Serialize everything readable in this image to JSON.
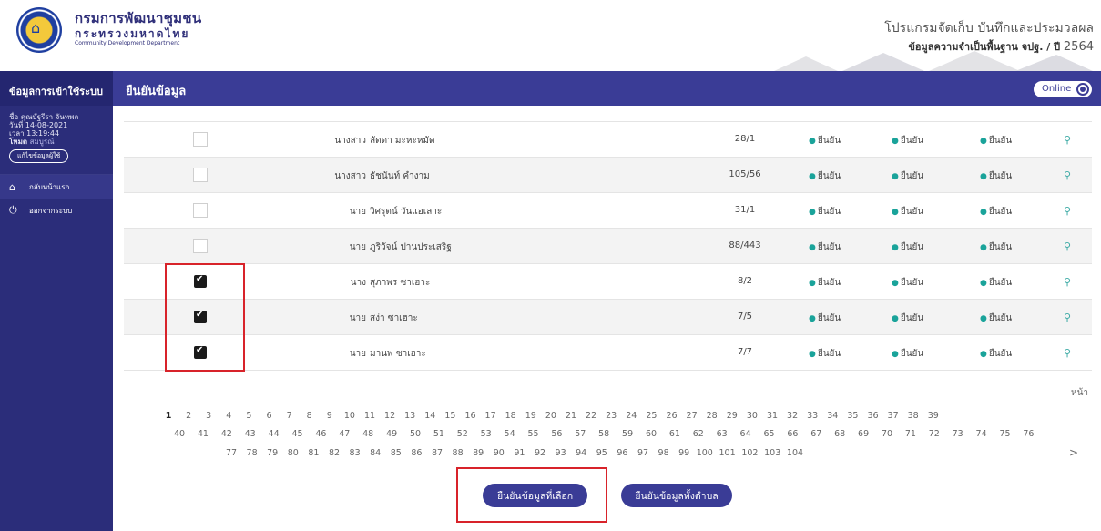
{
  "header": {
    "org_name_th": "กรมการพัฒนาชุมชน",
    "ministry_th": "กระทรวงมหาดไทย",
    "org_name_en": "Community Development Department",
    "app_title": "โปรแกรมจัดเก็บ บันทึกและประมวลผล",
    "app_subtitle": "ข้อมูลความจำเป็นพื้นฐาน จปฐ. / ปี",
    "app_year": "2564"
  },
  "sidebar": {
    "heading": "ข้อมูลการเข้าใช้ระบบ",
    "user_name": "ชื่อ คุณบัฐรีรา จันทพล",
    "date": "วันที่ 14-08-2021",
    "time": "เวลา 13:19:44",
    "role_label": "โหมด",
    "role_value": "สมบูรณ์",
    "edit_profile": "แก้ไขข้อมูลผู้ใช้",
    "menu": [
      {
        "icon": "home-icon",
        "label": "กลับหน้าแรก"
      },
      {
        "icon": "power-icon",
        "label": "ออกจากระบบ"
      }
    ]
  },
  "topbar": {
    "title": "ยืนยันข้อมูล",
    "status": "Online"
  },
  "table": {
    "status_label": "ยืนยัน",
    "rows": [
      {
        "title": "นางสาว",
        "name": "ลัดดา มะหะหมัด",
        "house": "28/1",
        "checked": false
      },
      {
        "title": "นางสาว",
        "name": "ธัชนันท์ คำงาม",
        "house": "105/56",
        "checked": false
      },
      {
        "title": "นาย",
        "name": "วิศรุตน์ วันแอเลาะ",
        "house": "31/1",
        "checked": false
      },
      {
        "title": "นาย",
        "name": "ภูริวัจน์ ปานประเสริฐ",
        "house": "88/443",
        "checked": false
      },
      {
        "title": "นาง",
        "name": "สุภาพร ซาเฮาะ",
        "house": "8/2",
        "checked": true
      },
      {
        "title": "นาย",
        "name": "สง่า ซาเฮาะ",
        "house": "7/5",
        "checked": true
      },
      {
        "title": "นาย",
        "name": "มานพ ซาเฮาะ",
        "house": "7/7",
        "checked": true
      }
    ],
    "action_icon": "view-icon"
  },
  "pagination": {
    "label": "หน้า",
    "current": 1,
    "total": 104,
    "next_symbol": ">"
  },
  "actions": {
    "confirm_selected": "ยืนยันข้อมูลที่เลือก",
    "confirm_all": "ยืนยันข้อมูลทั้งตำบล"
  }
}
